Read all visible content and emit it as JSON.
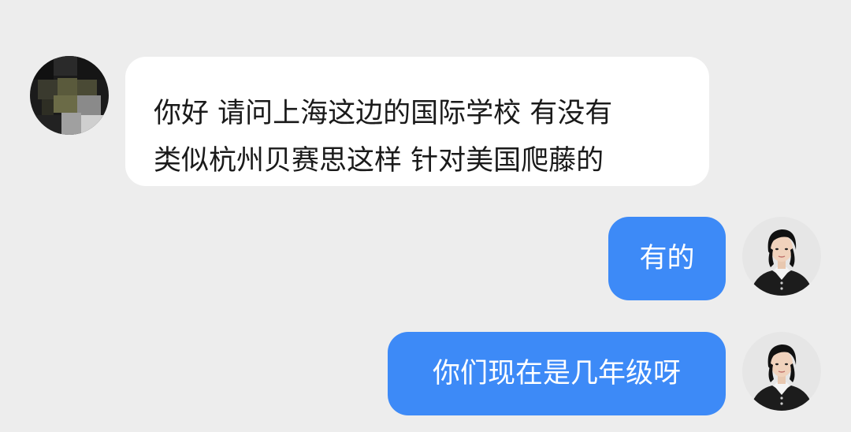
{
  "messages": [
    {
      "direction": "incoming",
      "text": "你好 请问上海这边的国际学校  有没有\n类似杭州贝赛思这样  针对美国爬藤的"
    },
    {
      "direction": "outgoing",
      "text": "有的"
    },
    {
      "direction": "outgoing",
      "text": "你们现在是几年级呀"
    }
  ],
  "colors": {
    "background": "#ededed",
    "incoming_bubble": "#ffffff",
    "outgoing_bubble": "#3d8af7",
    "outgoing_text": "#ffffff",
    "incoming_text": "#1a1a1a"
  },
  "avatars": {
    "contact": "pixelated-avatar-icon",
    "self": "user-photo-avatar-icon"
  }
}
